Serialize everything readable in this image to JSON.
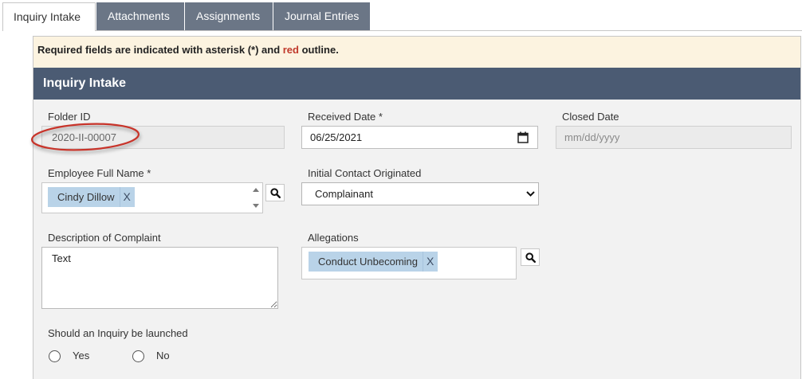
{
  "tabs": [
    {
      "label": "Inquiry Intake",
      "active": true
    },
    {
      "label": "Attachments",
      "active": false
    },
    {
      "label": "Assignments",
      "active": false
    },
    {
      "label": "Journal Entries",
      "active": false
    }
  ],
  "notice": {
    "prefix": "Required fields are indicated with asterisk (*) and ",
    "highlight": "red",
    "suffix": " outline."
  },
  "section": {
    "title": "Inquiry Intake"
  },
  "form": {
    "folder_id": {
      "label": "Folder ID",
      "value": "2020-II-00007",
      "read_only": true
    },
    "received_date": {
      "label": "Received Date *",
      "value": "06/25/2021",
      "required": true
    },
    "closed_date": {
      "label": "Closed Date",
      "placeholder": "mm/dd/yyyy",
      "value": ""
    },
    "employee_full_name": {
      "label": "Employee Full Name *",
      "required": true,
      "chips": [
        "Cindy Dillow"
      ],
      "remove_label": "X"
    },
    "initial_contact_originated": {
      "label": "Initial Contact Originated",
      "selected": "Complainant"
    },
    "description_of_complaint": {
      "label": "Description of Complaint",
      "value": "Text"
    },
    "allegations": {
      "label": "Allegations",
      "chips": [
        "Conduct Unbecoming"
      ],
      "remove_label": "X"
    },
    "inquiry_launched": {
      "label": "Should an Inquiry be launched",
      "options": [
        {
          "label": "Yes",
          "selected": false
        },
        {
          "label": "No",
          "selected": false
        }
      ]
    }
  },
  "icons": {
    "date_picker": "calendar-icon",
    "lookup": "search-icon",
    "dropdown": "chevron-down-icon",
    "scroll_up": "triangle-up-icon",
    "scroll_down": "triangle-down-icon"
  },
  "colors": {
    "tab_inactive": "#6b7686",
    "section_header": "#4b5b73",
    "notice_background": "#fcf3e0",
    "required_highlight": "#c0392b",
    "chip_background": "#b9d3e8",
    "form_background": "#f2f2f2",
    "annotation_outline": "#c8342a"
  }
}
